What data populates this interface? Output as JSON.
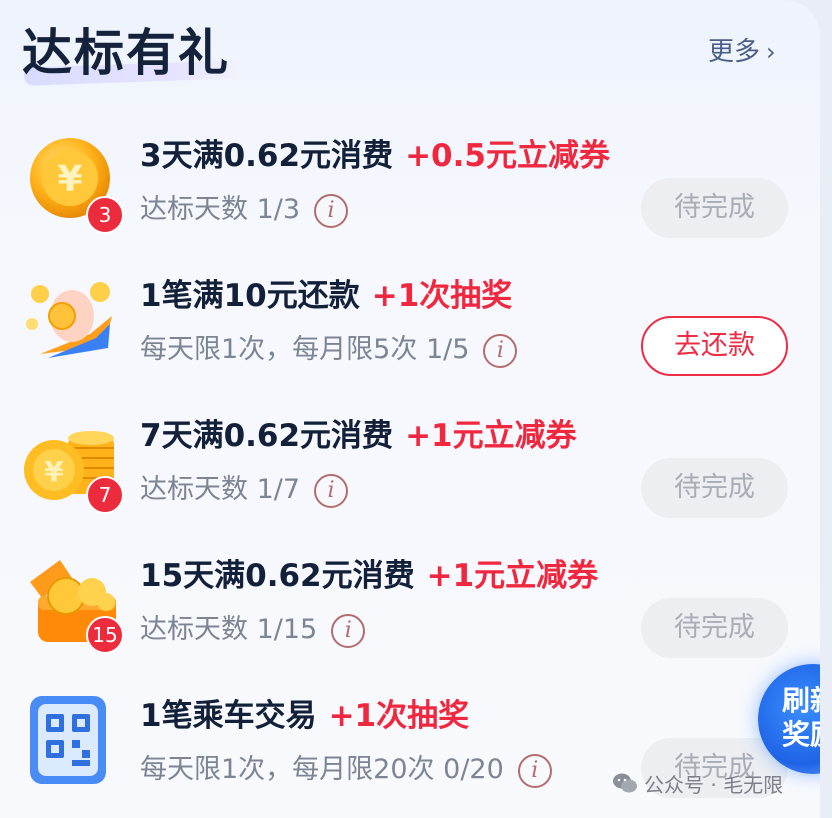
{
  "header": {
    "title": "达标有礼",
    "more_label": "更多",
    "more_chevron": "›"
  },
  "tasks": [
    {
      "icon": "coin-icon",
      "badge": "3",
      "name": "3天满0.62元消费",
      "reward": "+0.5元立减券",
      "progress_text": "达标天数",
      "progress": "1/3",
      "button": "待完成",
      "button_state": "pending"
    },
    {
      "icon": "hand-coins-icon",
      "badge": "",
      "name": "1笔满10元还款",
      "reward": "+1次抽奖",
      "progress_text": "每天限1次，每月限5次",
      "progress": "1/5",
      "button": "去还款",
      "button_state": "action"
    },
    {
      "icon": "coin-stack-icon",
      "badge": "7",
      "name": "7天满0.62元消费",
      "reward": "+1元立减券",
      "progress_text": "达标天数",
      "progress": "1/7",
      "button": "待完成",
      "button_state": "pending"
    },
    {
      "icon": "coin-box-icon",
      "badge": "15",
      "name": "15天满0.62元消费",
      "reward": "+1元立减券",
      "progress_text": "达标天数",
      "progress": "1/15",
      "button": "待完成",
      "button_state": "pending"
    },
    {
      "icon": "qr-code-icon",
      "badge": "",
      "name": "1笔乘车交易",
      "reward": "+1次抽奖",
      "progress_text": "每天限1次，每月限20次",
      "progress": "0/20",
      "button": "待完成",
      "button_state": "pending"
    }
  ],
  "info_symbol": "i",
  "floating_button": {
    "line1": "刷新",
    "line2": "奖励"
  },
  "watermark": "公众号 · 毛无限",
  "colors": {
    "accent_red": "#ec2d45",
    "title": "#15223b",
    "link": "#4b5f86",
    "badge_red": "#ec2b3d"
  }
}
